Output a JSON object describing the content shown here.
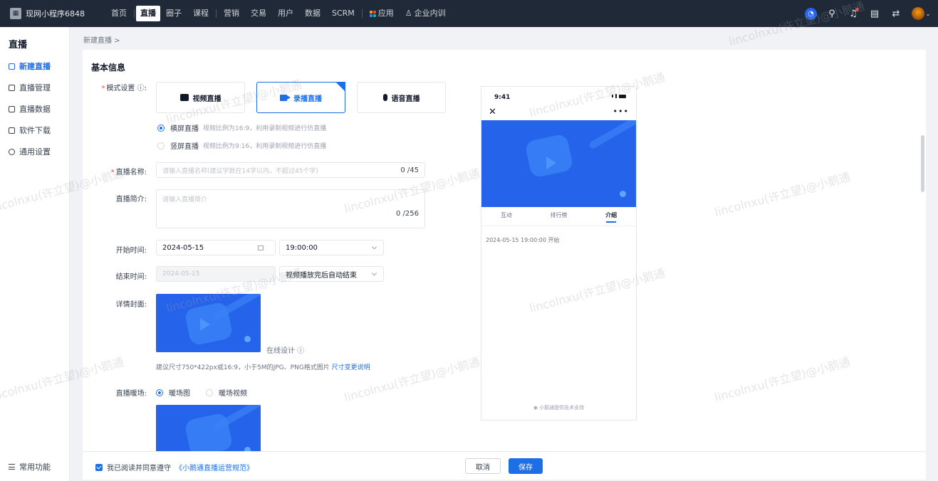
{
  "topbar": {
    "brand": "现网小程序6848",
    "nav": [
      "首页",
      "直播",
      "圈子",
      "课程",
      "营销",
      "交易",
      "用户",
      "数据",
      "SCRM",
      "应用",
      "企业内训"
    ],
    "active_nav": "直播"
  },
  "sidebar": {
    "title": "直播",
    "items": [
      "新建直播",
      "直播管理",
      "直播数据",
      "软件下载",
      "通用设置"
    ],
    "bottom": "常用功能"
  },
  "breadcrumb": "新建直播 >",
  "form": {
    "section_title": "基本信息",
    "mode_label": "模式设置 ⓘ:",
    "modes": [
      "视频直播",
      "录播直播",
      "语音直播"
    ],
    "orientation": [
      {
        "label": "横屏直播",
        "hint": "视频比例为16:9，利用录制视频进行仿直播",
        "selected": true
      },
      {
        "label": "竖屏直播",
        "hint": "视频比例为9:16，利用录制视频进行仿直播",
        "selected": false
      }
    ],
    "name_label": "直播名称:",
    "name_placeholder": "请输入直播名称(建议字数在14字以内，不超过45个字)",
    "name_counter": "0 /45",
    "intro_label": "直播简介:",
    "intro_placeholder": "请输入直播简介",
    "intro_counter": "0 /256",
    "start_label": "开始时间:",
    "start_date": "2024-05-15",
    "start_time": "19:00:00",
    "end_label": "结束时间:",
    "end_date": "2024-05-15",
    "end_option": "视频播放完后自动结束",
    "cover_label": "详情封面:",
    "online_design": "在线设计 ⓘ",
    "cover_note": "建议尺寸750*422px或16:9，小于5M的JPG、PNG格式图片",
    "cover_note_link": "尺寸变更说明",
    "warmup_label": "直播暖场:",
    "warmup_options": [
      "暖场图",
      "暖场视频"
    ]
  },
  "phone": {
    "time": "9:41",
    "tabs": [
      "互动",
      "排行榜",
      "介绍"
    ],
    "active_tab": "介绍",
    "start_text": "2024-05-15 19:00:00 开始",
    "footer": "小鹅通提供技术支持"
  },
  "bottom": {
    "agree_text": "我已阅读并同意遵守",
    "agree_link": "《小鹅通直播运营规范》",
    "cancel": "取消",
    "save": "保存"
  },
  "watermark": "lincolnxu(许立望)@小鹅通",
  "colors": {
    "accent": "#1d6fe8",
    "topbar": "#1f2937"
  }
}
